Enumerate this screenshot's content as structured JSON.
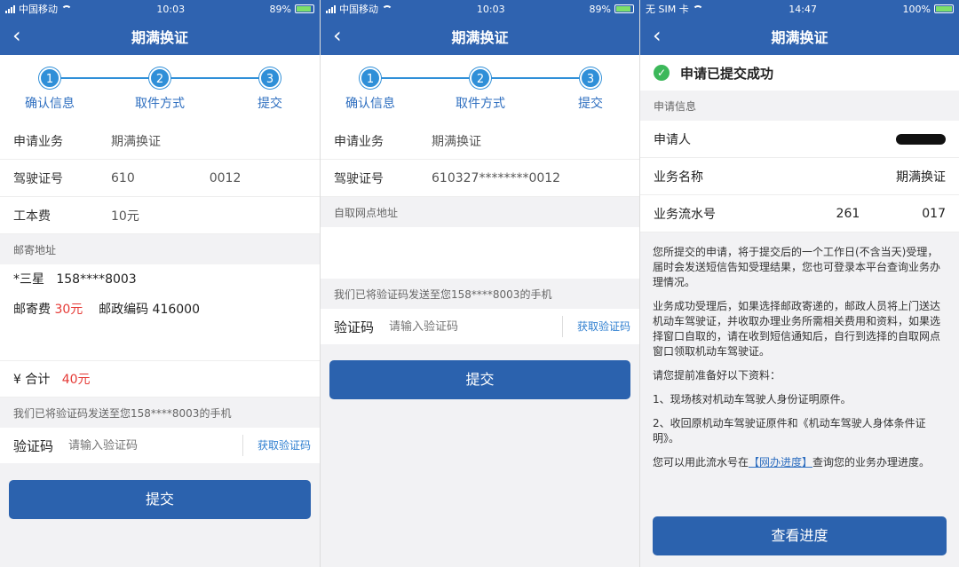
{
  "screens": [
    {
      "status": {
        "carrier": "中国移动",
        "time": "10:03",
        "battery": "89%",
        "battery_level": 0.89
      },
      "title": "期满换证",
      "steps": [
        "确认信息",
        "取件方式",
        "提交"
      ],
      "step_numbers": [
        "1",
        "2",
        "3"
      ],
      "rows": [
        {
          "k": "申请业务",
          "v": "期满换证"
        },
        {
          "k": "驾驶证号",
          "v": "610",
          "v2": "0012"
        },
        {
          "k": "工本费",
          "v": "10元"
        }
      ],
      "mail_label": "邮寄地址",
      "mail_name": "*三星",
      "mail_phone": "158****8003",
      "postage_label": "邮寄费",
      "postage": "30元",
      "postcode_label": "邮政编码",
      "postcode": "416000",
      "total_label": "¥ 合计",
      "total": "40元",
      "sms_note": "我们已将验证码发送至您158****8003的手机",
      "code_label": "验证码",
      "code_placeholder": "请输入验证码",
      "get_code": "获取验证码",
      "submit": "提交"
    },
    {
      "status": {
        "carrier": "中国移动",
        "time": "10:03",
        "battery": "89%",
        "battery_level": 0.89
      },
      "title": "期满换证",
      "steps": [
        "确认信息",
        "取件方式",
        "提交"
      ],
      "step_numbers": [
        "1",
        "2",
        "3"
      ],
      "rows": [
        {
          "k": "申请业务",
          "v": "期满换证"
        },
        {
          "k": "驾驶证号",
          "v": "610327********0012"
        }
      ],
      "pickup_label": "自取网点地址",
      "sms_note": "我们已将验证码发送至您158****8003的手机",
      "code_label": "验证码",
      "code_placeholder": "请输入验证码",
      "get_code": "获取验证码",
      "submit": "提交"
    },
    {
      "status": {
        "carrier": "无 SIM 卡",
        "time": "14:47",
        "battery": "100%",
        "battery_level": 1.0
      },
      "title": "期满换证",
      "success": "申请已提交成功",
      "info_label": "申请信息",
      "rows": [
        {
          "k": "申请人",
          "v": ""
        },
        {
          "k": "业务名称",
          "v": "期满换证"
        },
        {
          "k": "业务流水号",
          "v": "261",
          "v2": "017"
        }
      ],
      "notes": [
        "您所提交的申请，将于提交后的一个工作日(不含当天)受理，届时会发送短信告知受理结果，您也可登录本平台查询业务办理情况。",
        "业务成功受理后，如果选择邮政寄递的，邮政人员将上门送达机动车驾驶证，并收取办理业务所需相关费用和资料，如果选择窗口自取的，请在收到短信通知后，自行到选择的自取网点窗口领取机动车驾驶证。",
        "请您提前准备好以下资料：",
        "1、现场核对机动车驾驶人身份证明原件。",
        "2、收回原机动车驾驶证原件和《机动车驾驶人身体条件证明》。"
      ],
      "progress_note_pre": "您可以用此流水号在",
      "progress_link": "【网办进度】",
      "progress_note_post": "查询您的业务办理进度。",
      "button": "查看进度"
    }
  ]
}
